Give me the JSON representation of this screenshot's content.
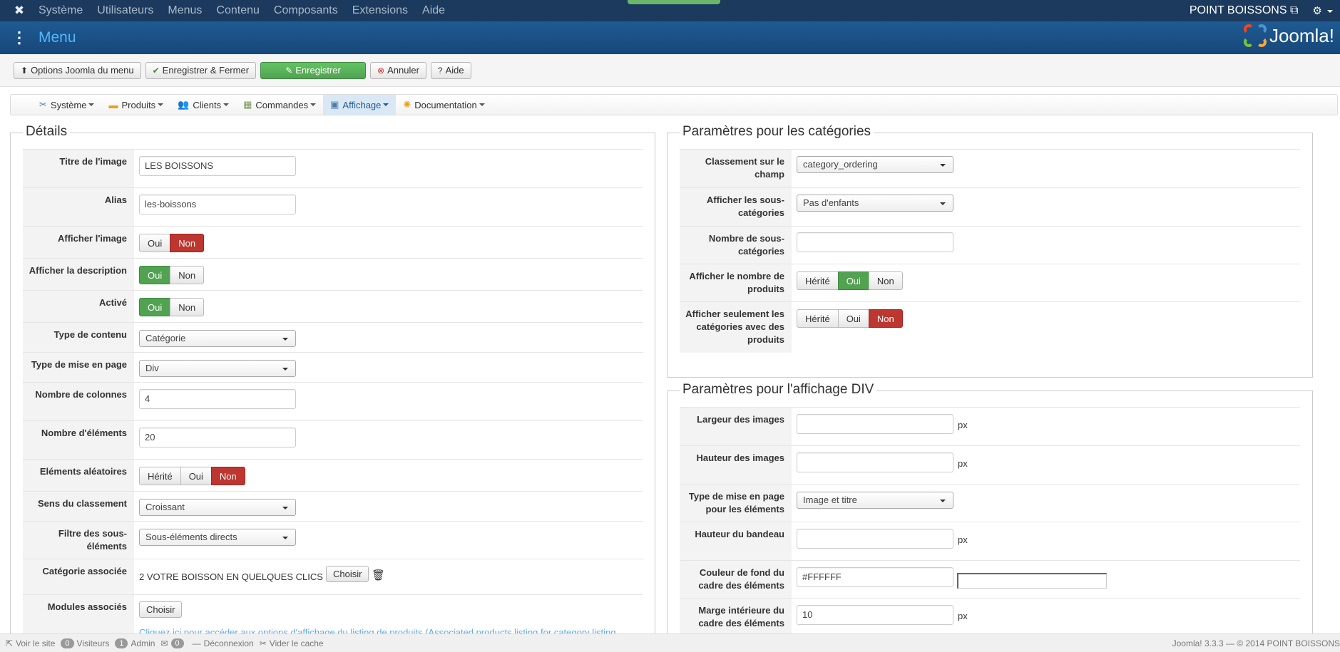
{
  "topnav": {
    "menus": [
      "Système",
      "Utilisateurs",
      "Menus",
      "Contenu",
      "Composants",
      "Extensions",
      "Aide"
    ],
    "site_name": "POINT BOISSONS"
  },
  "header": {
    "title": "Menu",
    "brand": "Joomla!"
  },
  "toolbar": {
    "options": "Options Joomla du menu",
    "save_close": "Enregistrer & Fermer",
    "save": "Enregistrer",
    "cancel": "Annuler",
    "help": "Aide"
  },
  "subnav": {
    "items": [
      "Système",
      "Produits",
      "Clients",
      "Commandes",
      "Affichage",
      "Documentation"
    ],
    "active": "Affichage"
  },
  "details": {
    "legend": "Détails",
    "titre_image": {
      "label": "Titre de l'image",
      "value": "LES BOISSONS"
    },
    "alias": {
      "label": "Alias",
      "value": "les-boissons"
    },
    "afficher_image": {
      "label": "Afficher l'image",
      "options": [
        "Oui",
        "Non"
      ],
      "selected": "Non"
    },
    "afficher_description": {
      "label": "Afficher la description",
      "options": [
        "Oui",
        "Non"
      ],
      "selected": "Oui"
    },
    "active": {
      "label": "Activé",
      "options": [
        "Oui",
        "Non"
      ],
      "selected": "Oui"
    },
    "type_contenu": {
      "label": "Type de contenu",
      "value": "Catégorie"
    },
    "type_mise_en_page": {
      "label": "Type de mise en page",
      "value": "Div"
    },
    "nombre_colonnes": {
      "label": "Nombre de colonnes",
      "value": "4"
    },
    "nombre_elements": {
      "label": "Nombre d'éléments",
      "value": "20"
    },
    "elements_aleatoires": {
      "label": "Eléments aléatoires",
      "options": [
        "Hérité",
        "Oui",
        "Non"
      ],
      "selected": "Non"
    },
    "sens_classement": {
      "label": "Sens du classement",
      "value": "Croissant"
    },
    "filtre_sous_elements": {
      "label": "Filtre des sous-éléments",
      "value": "Sous-éléments directs"
    },
    "categorie_associee": {
      "label": "Catégorie associée",
      "value": "2 VOTRE BOISSON EN QUELQUES CLICS",
      "button": "Choisir"
    },
    "modules_associes": {
      "label": "Modules associés",
      "button": "Choisir",
      "link": "Cliquez ici pour accéder aux options d'affichage du listing de produits (Associated products listing for category listing"
    }
  },
  "categories": {
    "legend": "Paramètres pour les catégories",
    "classement": {
      "label": "Classement sur le champ",
      "value": "category_ordering"
    },
    "afficher_sous_categories": {
      "label": "Afficher les sous-catégories",
      "value": "Pas d'enfants"
    },
    "nombre_sous_categories": {
      "label": "Nombre de sous-catégories",
      "value": ""
    },
    "afficher_nombre_produits": {
      "label": "Afficher le nombre de produits",
      "options": [
        "Hérité",
        "Oui",
        "Non"
      ],
      "selected": "Oui"
    },
    "afficher_seulement": {
      "label": "Afficher seulement les catégories avec des produits",
      "options": [
        "Hérité",
        "Oui",
        "Non"
      ],
      "selected": "Non"
    }
  },
  "div": {
    "legend": "Paramètres pour l'affichage DIV",
    "largeur_images": {
      "label": "Largeur des images",
      "value": "",
      "unit": "px"
    },
    "hauteur_images": {
      "label": "Hauteur des images",
      "value": "",
      "unit": "px"
    },
    "type_mise_en_page": {
      "label": "Type de mise en page pour les éléments",
      "value": "Image et titre"
    },
    "hauteur_bandeau": {
      "label": "Hauteur du bandeau",
      "value": "",
      "unit": "px"
    },
    "couleur_fond": {
      "label": "Couleur de fond du cadre des éléments",
      "value": "#FFFFFF"
    },
    "marge_interieure": {
      "label": "Marge intérieure du cadre des éléments",
      "value": "10",
      "unit": "px"
    }
  },
  "statusbar": {
    "voir_site": "Voir le site",
    "visiteurs_count": "0",
    "visiteurs": "Visiteurs",
    "admin_count": "1",
    "admin": "Admin",
    "messages_count": "0",
    "deconnexion": "Déconnexion",
    "vider_cache": "Vider le cache",
    "version": "Joomla! 3.3.3 — © 2014 POINT BOISSONS"
  },
  "colors": {
    "topnav": "#1b3a5e",
    "header": "#1e5b93",
    "success": "#51a351",
    "danger": "#bd362f",
    "active_tab": "#d9e8f4"
  }
}
